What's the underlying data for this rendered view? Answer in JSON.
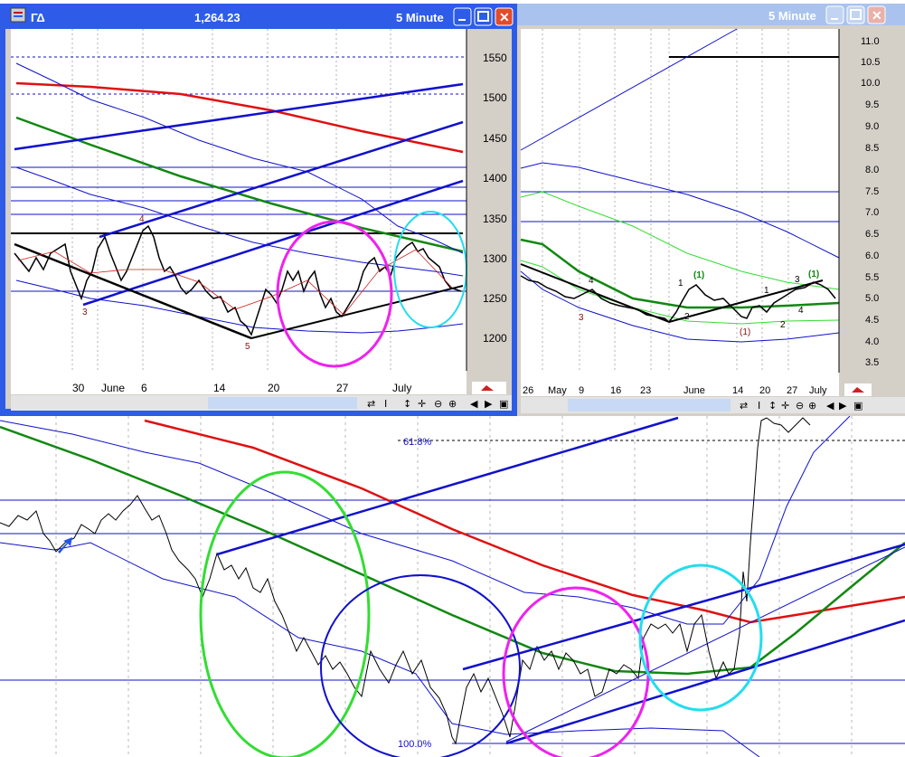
{
  "left_window": {
    "title": "ΓΔ",
    "price": "1,264.23",
    "interval": "5 Minute",
    "y_ticks": [
      "1550",
      "1500",
      "1450",
      "1400",
      "1350",
      "1300",
      "1250",
      "1200"
    ],
    "x_ticks": [
      "30",
      "June",
      "6",
      "14",
      "20",
      "27",
      "July"
    ],
    "wave_labels": [
      "3",
      "4",
      "5"
    ]
  },
  "right_window": {
    "interval": "5 Minute",
    "y_ticks": [
      "11.0",
      "10.5",
      "10.0",
      "9.5",
      "9.0",
      "8.5",
      "8.0",
      "7.5",
      "7.0",
      "6.5",
      "6.0",
      "5.5",
      "5.0",
      "4.5",
      "4.0",
      "3.5"
    ],
    "x_ticks": [
      "26",
      "May",
      "9",
      "16",
      "23",
      "June",
      "14",
      "20",
      "27",
      "July"
    ],
    "wave_labels": [
      "4",
      "3",
      "1",
      "(1)",
      "2",
      "(1)",
      "1",
      "3",
      "(1)",
      "4",
      "2"
    ]
  },
  "background_chart": {
    "fib_labels": [
      "61.8%",
      "100.0%"
    ],
    "edge_text": "ick"
  },
  "colors": {
    "titlebar": "#2e5ce8",
    "scrollbar_thumb": "#c7d9f5",
    "red": "#e01010",
    "green": "#118811",
    "blue": "#1010cc",
    "magenta": "#ee22ee",
    "cyan": "#22ddee",
    "lime": "#33dd33"
  },
  "icons": [
    "chart-app-icon",
    "minimize-icon",
    "maximize-icon",
    "close-icon",
    "scroll-left-icon",
    "scroll-right-icon",
    "zoom-in-icon",
    "zoom-out-icon",
    "pan-icon",
    "crosshair-icon",
    "refresh-icon",
    "info-icon",
    "grid-icon"
  ]
}
